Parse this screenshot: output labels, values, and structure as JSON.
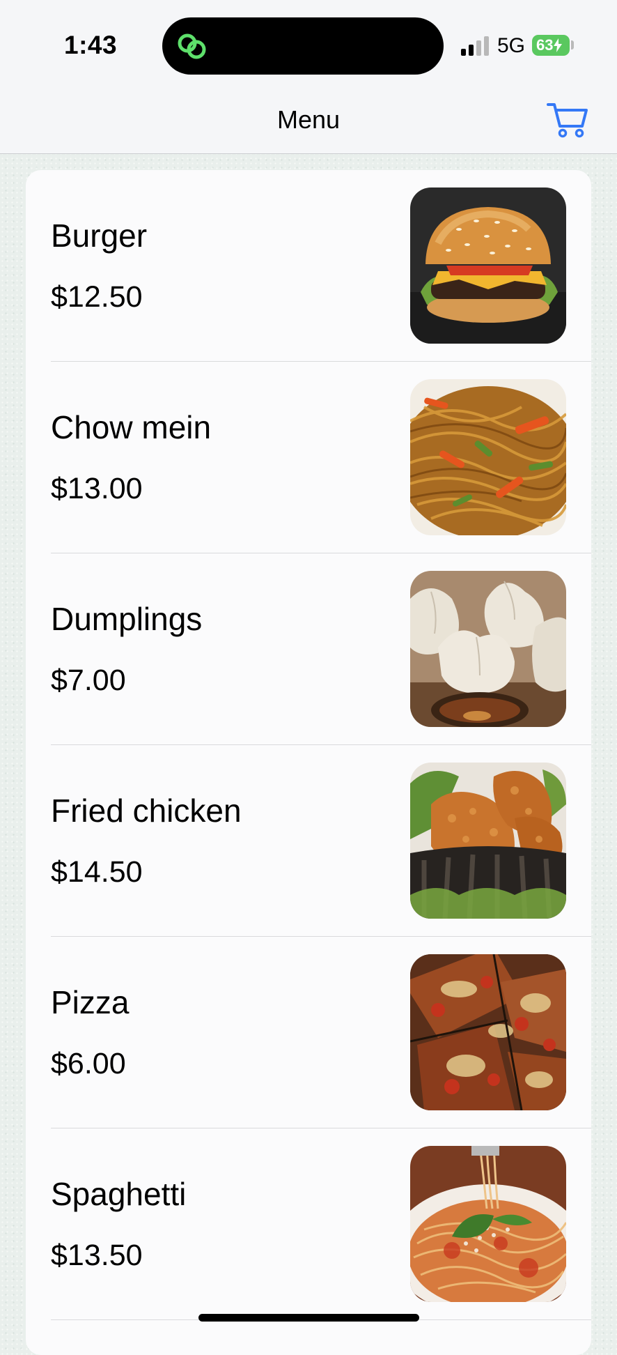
{
  "status_bar": {
    "time": "1:43",
    "network": "5G",
    "battery": "63"
  },
  "nav": {
    "title": "Menu",
    "cart_icon": "cart-icon"
  },
  "menu": {
    "items": [
      {
        "name": "Burger",
        "price": "$12.50",
        "image": "burger-photo"
      },
      {
        "name": "Chow mein",
        "price": "$13.00",
        "image": "chow-mein-photo"
      },
      {
        "name": "Dumplings",
        "price": "$7.00",
        "image": "dumplings-photo"
      },
      {
        "name": "Fried chicken",
        "price": "$14.50",
        "image": "fried-chicken-photo"
      },
      {
        "name": "Pizza",
        "price": "$6.00",
        "image": "pizza-photo"
      },
      {
        "name": "Spaghetti",
        "price": "$13.50",
        "image": "spaghetti-photo"
      }
    ]
  },
  "colors": {
    "accent": "#3478f6",
    "battery": "#5ac85f",
    "island_icon": "#5ee06b"
  }
}
